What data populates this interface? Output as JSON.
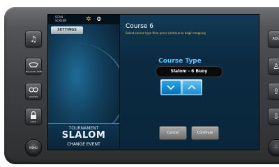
{
  "status": {
    "label": "SCAN\nSCREEN",
    "value": "0",
    "sun_icon": "sun-icon"
  },
  "left": {
    "settings_label": "SETTINGS",
    "event_top": "TOURNAMENT",
    "event_main": "SLALOM",
    "event_change": "CHANGE EVENT"
  },
  "dialog": {
    "title": "Course 6",
    "instructions": "Select course type then press continue to begin mapping",
    "type_label": "Course Type",
    "type_value": "Slalom - 6 Buoy",
    "cancel_label": "Cancel",
    "continue_label": "Continue"
  },
  "side_buttons": {
    "left": [
      {
        "name": "music-icon",
        "glyph": "♫",
        "caption": ""
      },
      {
        "name": "ballast-icon",
        "glyph": "",
        "caption": "BALLAST\n+TRIM"
      },
      {
        "name": "gauges-icon",
        "glyph": "∞",
        "caption": "GAUGES"
      },
      {
        "name": "lock-icon",
        "glyph": "",
        "caption": "LOCK"
      }
    ],
    "left_menu": "MENU",
    "right": [
      {
        "name": "add-icon",
        "glyph": "ADD"
      },
      {
        "name": "person-icon",
        "glyph": "♙"
      },
      {
        "name": "arrow-up-icon",
        "glyph": "⇧"
      },
      {
        "name": "arrow-down-icon",
        "glyph": "⇩"
      }
    ]
  },
  "colors": {
    "accent_yellow": "#f2c94c",
    "accent_blue": "#5fc6ff",
    "screen_bg": "#0a2b3f"
  }
}
